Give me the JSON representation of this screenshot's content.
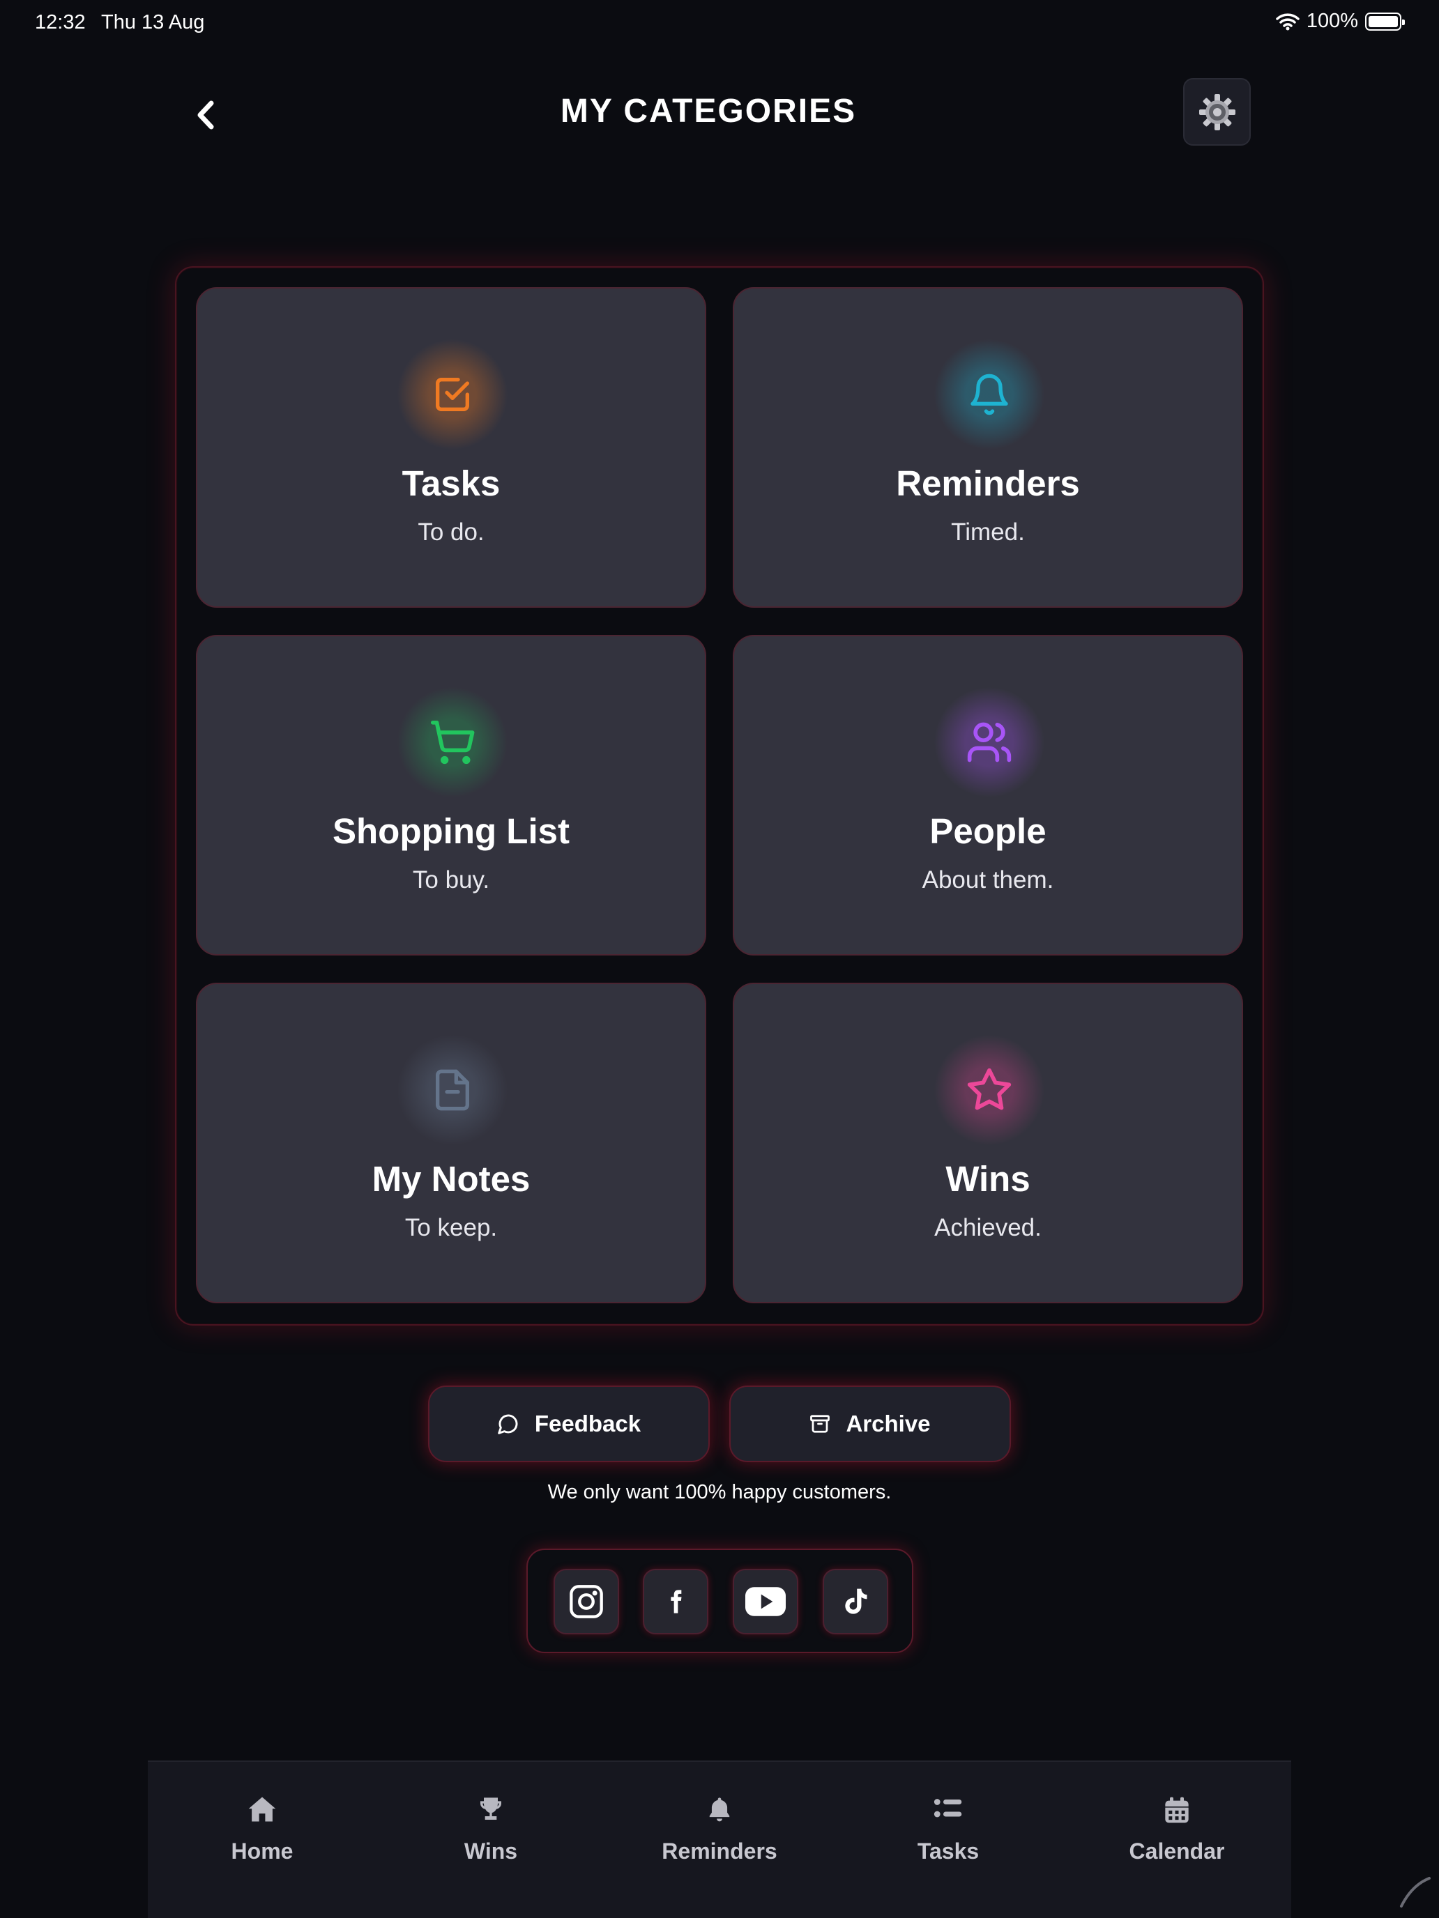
{
  "status_bar": {
    "time": "12:32",
    "date": "Thu 13 Aug",
    "battery": "100%"
  },
  "header": {
    "title": "MY CATEGORIES"
  },
  "categories": [
    {
      "title": "Tasks",
      "subtitle": "To do.",
      "icon": "checkbox-icon",
      "color": "#f07a22"
    },
    {
      "title": "Reminders",
      "subtitle": "Timed.",
      "icon": "bell-icon",
      "color": "#1eb3d1"
    },
    {
      "title": "Shopping List",
      "subtitle": "To buy.",
      "icon": "cart-icon",
      "color": "#22c55e"
    },
    {
      "title": "People",
      "subtitle": "About them.",
      "icon": "users-icon",
      "color": "#a855f7"
    },
    {
      "title": "My Notes",
      "subtitle": "To keep.",
      "icon": "document-icon",
      "color": "#64748b"
    },
    {
      "title": "Wins",
      "subtitle": "Achieved.",
      "icon": "star-icon",
      "color": "#ec4899"
    }
  ],
  "actions": {
    "feedback_label": "Feedback",
    "archive_label": "Archive"
  },
  "tagline": "We only want 100% happy customers.",
  "social": [
    "instagram-icon",
    "facebook-icon",
    "youtube-icon",
    "tiktok-icon"
  ],
  "tabs": [
    {
      "label": "Home",
      "icon": "home-icon"
    },
    {
      "label": "Wins",
      "icon": "trophy-icon"
    },
    {
      "label": "Reminders",
      "icon": "bell-icon"
    },
    {
      "label": "Tasks",
      "icon": "list-icon"
    },
    {
      "label": "Calendar",
      "icon": "calendar-icon"
    }
  ],
  "colors": {
    "background": "#0b0c11",
    "card": "#33333e",
    "accent_glow": "#c8142d"
  }
}
